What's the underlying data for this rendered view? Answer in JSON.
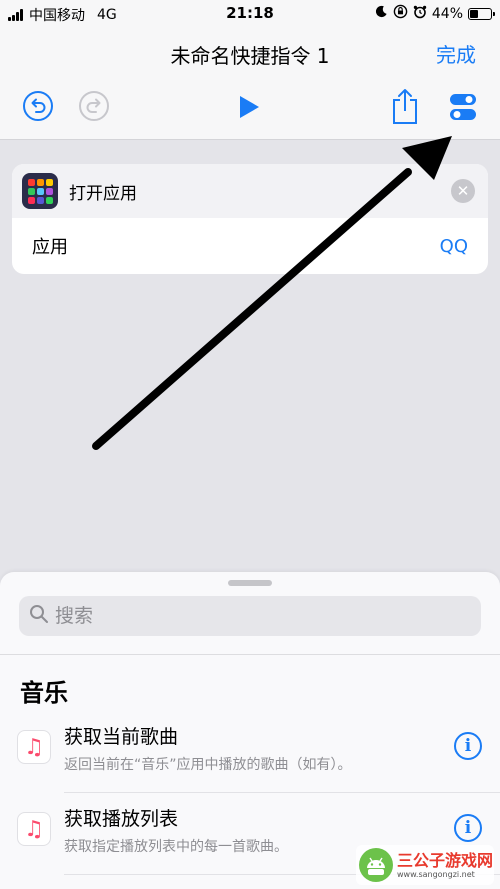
{
  "status_bar": {
    "carrier": "中国移动",
    "network": "4G",
    "time": "21:18",
    "battery": "44%",
    "battery_level": 0.44
  },
  "nav": {
    "title": "未命名快捷指令 1",
    "done_label": "完成"
  },
  "toolbar": {
    "undo_icon": "undo-icon",
    "redo_icon": "redo-icon",
    "play_icon": "play-icon",
    "share_icon": "share-icon",
    "settings_icon": "toggle-settings-icon"
  },
  "action_card": {
    "title": "打开应用",
    "param_label": "应用",
    "param_value": "QQ"
  },
  "search": {
    "placeholder": "搜索"
  },
  "section": {
    "title": "音乐"
  },
  "items": [
    {
      "title": "获取当前歌曲",
      "subtitle": "返回当前在“音乐”应用中播放的歌曲（如有）。",
      "icon": "music-note-icon"
    },
    {
      "title": "获取播放列表",
      "subtitle": "获取指定播放列表中的每一首歌曲。",
      "icon": "music-note-icon"
    }
  ],
  "watermark": {
    "name": "三公子游戏网",
    "url": "www.sangongzi.net"
  },
  "colors": {
    "accent": "#1a7cf5",
    "background": "#e4e4e9",
    "music": "#fb4b6d"
  }
}
